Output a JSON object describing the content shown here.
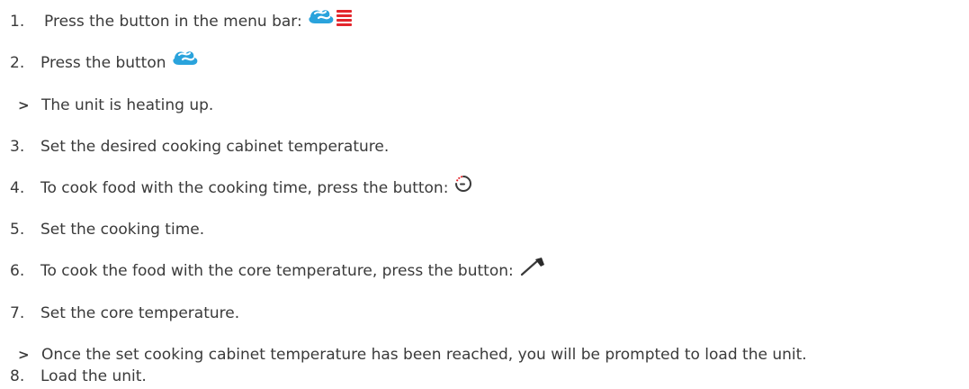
{
  "colors": {
    "text": "#3a3a3a",
    "steam_blue": "#2aa3dc",
    "hot_red": "#e3262c"
  },
  "steps": [
    {
      "marker": "1.",
      "text": "Press the button in the menu bar:",
      "icon": "steam-heat-icon"
    },
    {
      "marker": "2.",
      "text": "Press the button",
      "icon": "steam-icon"
    },
    {
      "marker": ">",
      "text": "The unit is heating up."
    },
    {
      "marker": "3.",
      "text": "Set the desired cooking cabinet temperature."
    },
    {
      "marker": "4.",
      "text": "To cook food with the cooking time, press the button:",
      "icon": "timer-icon"
    },
    {
      "marker": "5.",
      "text": "Set the cooking time."
    },
    {
      "marker": "6.",
      "text": "To cook the food with the core temperature, press the button:",
      "icon": "core-probe-icon"
    },
    {
      "marker": "7.",
      "text": "Set the core temperature."
    },
    {
      "marker": ">",
      "text": "Once the set cooking cabinet temperature has been reached, you will be prompted to load the unit."
    },
    {
      "marker": "8.",
      "text": "Load the unit."
    }
  ]
}
